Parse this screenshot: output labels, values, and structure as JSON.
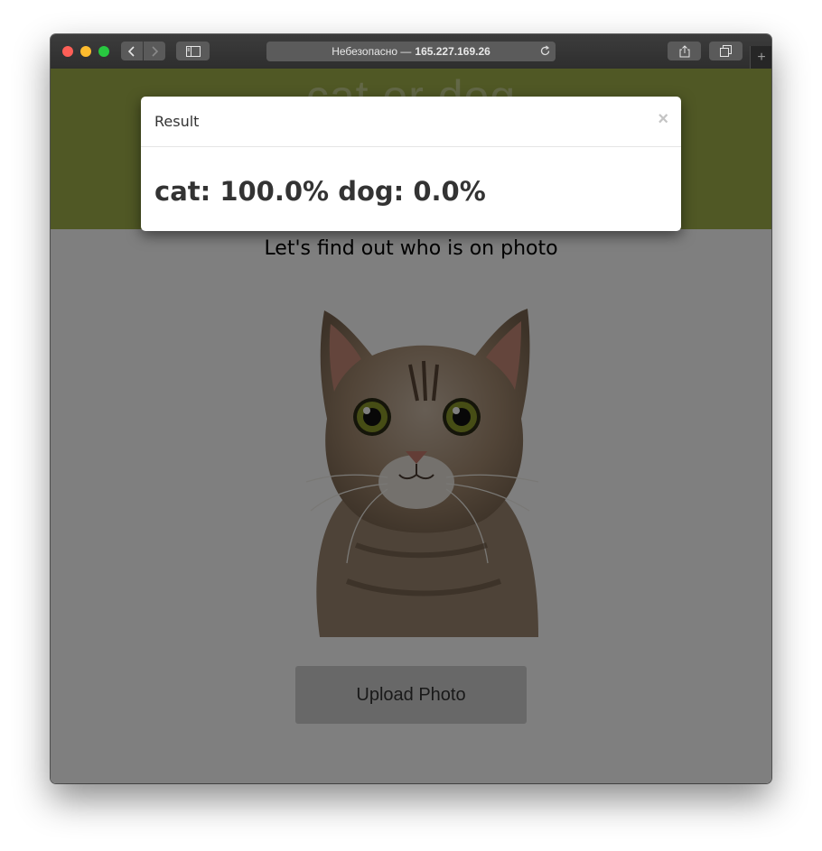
{
  "browser": {
    "address_prefix": "Небезопасно —",
    "address_host": "165.227.169.26",
    "plus_label": "+"
  },
  "page": {
    "site_title": "cat or dog",
    "subtitle": "Let's find out who is on photo",
    "upload_label": "Upload Photo"
  },
  "modal": {
    "title": "Result",
    "close_label": "×",
    "result_text": "cat: 100.0% dog: 0.0%"
  },
  "colors": {
    "header": "#a1b04a",
    "backdrop": "rgba(0,0,0,0.5)"
  },
  "icons": [
    "back-icon",
    "forward-icon",
    "sidebar-icon",
    "reload-icon",
    "share-icon",
    "tabs-icon"
  ]
}
